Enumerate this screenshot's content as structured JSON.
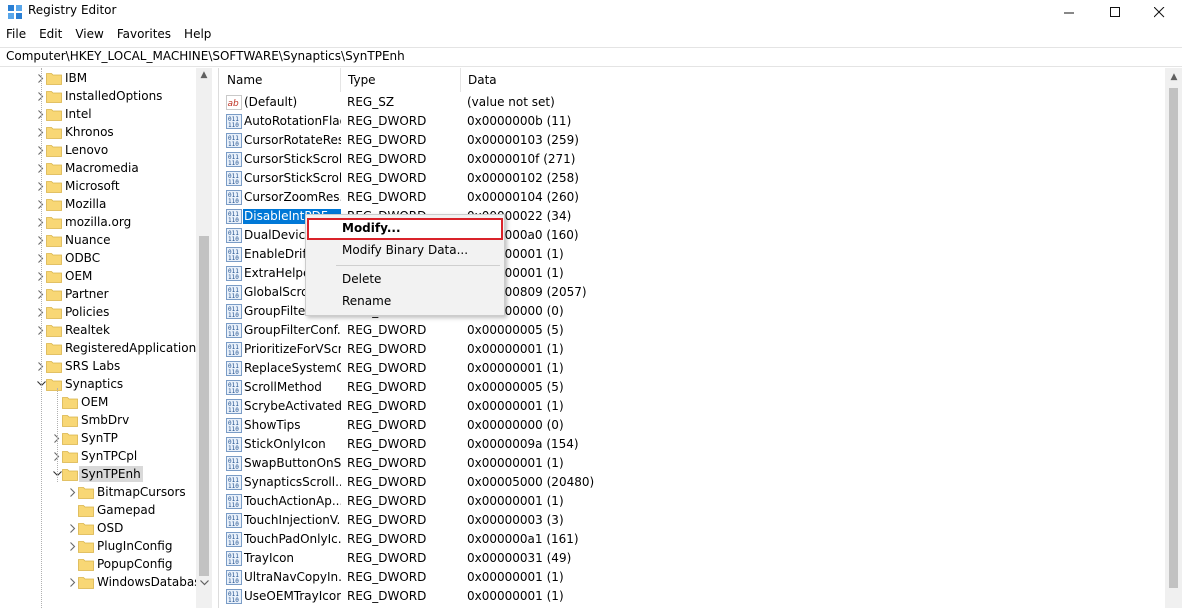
{
  "window": {
    "title": "Registry Editor"
  },
  "menu": [
    "File",
    "Edit",
    "View",
    "Favorites",
    "Help"
  ],
  "address": "Computer\\HKEY_LOCAL_MACHINE\\SOFTWARE\\Synaptics\\SynTPEnh",
  "tree": {
    "level1": [
      "IBM",
      "InstalledOptions",
      "Intel",
      "Khronos",
      "Lenovo",
      "Macromedia",
      "Microsoft",
      "Mozilla",
      "mozilla.org",
      "Nuance",
      "ODBC",
      "OEM",
      "Partner",
      "Policies",
      "Realtek",
      "RegisteredApplications",
      "SRS Labs",
      "Synaptics"
    ],
    "synaptics_children": [
      "OEM",
      "SmbDrv",
      "SynTP",
      "SynTPCpl",
      "SynTPEnh"
    ],
    "syntpenh_children": [
      "BitmapCursors",
      "Gamepad",
      "OSD",
      "PlugInConfig",
      "PopupConfig",
      "WindowsDatabase"
    ],
    "selected": "SynTPEnh"
  },
  "columns": {
    "name": "Name",
    "type": "Type",
    "data": "Data"
  },
  "values": [
    {
      "name": "(Default)",
      "type": "REG_SZ",
      "data": "(value not set)",
      "icon": "string-value-icon"
    },
    {
      "name": "AutoRotationFlag",
      "type": "REG_DWORD",
      "data": "0x0000000b (11)",
      "icon": "binary-value-icon"
    },
    {
      "name": "CursorRotateRes...",
      "type": "REG_DWORD",
      "data": "0x00000103 (259)",
      "icon": "binary-value-icon"
    },
    {
      "name": "CursorStickScrol...",
      "type": "REG_DWORD",
      "data": "0x0000010f (271)",
      "icon": "binary-value-icon"
    },
    {
      "name": "CursorStickScrol...",
      "type": "REG_DWORD",
      "data": "0x00000102 (258)",
      "icon": "binary-value-icon"
    },
    {
      "name": "CursorZoomRes...",
      "type": "REG_DWORD",
      "data": "0x00000104 (260)",
      "icon": "binary-value-icon"
    },
    {
      "name": "DisableIntPDF...",
      "type": "REG_DWORD",
      "data": "0x00000022 (34)",
      "icon": "binary-value-icon",
      "selected": true
    },
    {
      "name": "DualDeviceI...",
      "type": "REG_DWORD",
      "data": "0x000000a0 (160)",
      "icon": "binary-value-icon"
    },
    {
      "name": "EnableDriftC...",
      "type": "REG_DWORD",
      "data": "0x00000001 (1)",
      "icon": "binary-value-icon"
    },
    {
      "name": "ExtraHelper...",
      "type": "REG_DWORD",
      "data": "0x00000001 (1)",
      "icon": "binary-value-icon"
    },
    {
      "name": "GlobalScroll...",
      "type": "REG_DWORD",
      "data": "0x00000809 (2057)",
      "icon": "binary-value-icon"
    },
    {
      "name": "GroupFilterConfig",
      "type": "REG_DWORD",
      "data": "0x00000000 (0)",
      "icon": "binary-value-icon"
    },
    {
      "name": "GroupFilterConf...",
      "type": "REG_DWORD",
      "data": "0x00000005 (5)",
      "icon": "binary-value-icon"
    },
    {
      "name": "PrioritizeForVScr...",
      "type": "REG_DWORD",
      "data": "0x00000001 (1)",
      "icon": "binary-value-icon"
    },
    {
      "name": "ReplaceSystemC...",
      "type": "REG_DWORD",
      "data": "0x00000001 (1)",
      "icon": "binary-value-icon"
    },
    {
      "name": "ScrollMethod",
      "type": "REG_DWORD",
      "data": "0x00000005 (5)",
      "icon": "binary-value-icon"
    },
    {
      "name": "ScrybeActivated...",
      "type": "REG_DWORD",
      "data": "0x00000001 (1)",
      "icon": "binary-value-icon"
    },
    {
      "name": "ShowTips",
      "type": "REG_DWORD",
      "data": "0x00000000 (0)",
      "icon": "binary-value-icon"
    },
    {
      "name": "StickOnlyIcon",
      "type": "REG_DWORD",
      "data": "0x0000009a (154)",
      "icon": "binary-value-icon"
    },
    {
      "name": "SwapButtonOnS...",
      "type": "REG_DWORD",
      "data": "0x00000001 (1)",
      "icon": "binary-value-icon"
    },
    {
      "name": "SynapticsScroll...",
      "type": "REG_DWORD",
      "data": "0x00005000 (20480)",
      "icon": "binary-value-icon"
    },
    {
      "name": "TouchActionAp...",
      "type": "REG_DWORD",
      "data": "0x00000001 (1)",
      "icon": "binary-value-icon"
    },
    {
      "name": "TouchInjectionV...",
      "type": "REG_DWORD",
      "data": "0x00000003 (3)",
      "icon": "binary-value-icon"
    },
    {
      "name": "TouchPadOnlyIc...",
      "type": "REG_DWORD",
      "data": "0x000000a1 (161)",
      "icon": "binary-value-icon"
    },
    {
      "name": "TrayIcon",
      "type": "REG_DWORD",
      "data": "0x00000031 (49)",
      "icon": "binary-value-icon"
    },
    {
      "name": "UltraNavCopyIn...",
      "type": "REG_DWORD",
      "data": "0x00000001 (1)",
      "icon": "binary-value-icon"
    },
    {
      "name": "UseOEMTrayIcon",
      "type": "REG_DWORD",
      "data": "0x00000001 (1)",
      "icon": "binary-value-icon"
    }
  ],
  "context_menu": {
    "modify": "Modify...",
    "modify_binary": "Modify Binary Data...",
    "delete": "Delete",
    "rename": "Rename"
  },
  "colors": {
    "selection": "#0078d7",
    "highlight_border": "#d9232a",
    "folder": "#f8d775"
  }
}
